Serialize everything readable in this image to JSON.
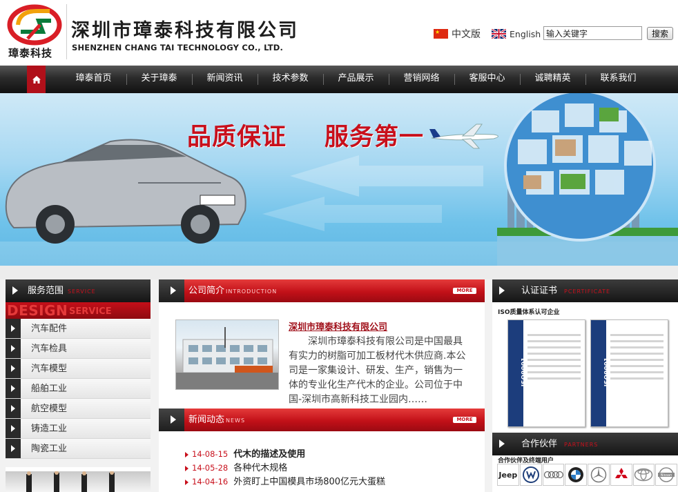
{
  "header": {
    "logo_short": "璋泰科技",
    "company_cn": "深圳市璋泰科技有限公司",
    "company_en": "SHENZHEN CHANG TAI TECHNOLOGY CO., LTD.",
    "lang_cn": "中文版",
    "lang_en": "English",
    "search_value": "输入关键字",
    "search_button": "搜索"
  },
  "nav": {
    "home_icon": "home-icon",
    "items": [
      "璋泰首页",
      "关于璋泰",
      "新闻资讯",
      "技术参数",
      "产品展示",
      "营销网络",
      "客服中心",
      "诚聘精英",
      "联系我们"
    ]
  },
  "banner": {
    "slogan_1": "品质保证",
    "slogan_2": "服务第一"
  },
  "services": {
    "title": "服务范围",
    "title_en": "SERVICE",
    "band_text": "DESIGN",
    "band_text_2": "SERVICE",
    "items": [
      "汽车配件",
      "汽车检具",
      "汽车模型",
      "船舶工业",
      "航空模型",
      "铸造工业",
      "陶瓷工业"
    ]
  },
  "intro": {
    "title": "公司简介",
    "title_en": "INTRODUCTION",
    "more": "MORE",
    "company": "深圳市璋泰科技有限公司",
    "text": "深圳市璋泰科技有限公司是中国最具有实力的树脂可加工板材代木供应商.本公司是一家集设计、研发、生产，销售为一体的专业化生产代木的企业。公司位于中国-深圳市高新科技工业园内……"
  },
  "news": {
    "title": "新闻动态",
    "title_en": "NEWS",
    "more": "MORE",
    "items": [
      {
        "date": "14-08-15",
        "title": "代木的描述及使用"
      },
      {
        "date": "14-05-28",
        "title": "各种代木规格"
      },
      {
        "date": "14-04-16",
        "title": "外资盯上中国模具市场800亿元大蛋糕"
      }
    ]
  },
  "certificate": {
    "title": "认证证书",
    "title_en": "PCERTIFICATE",
    "subtitle": "ISO质量体系认可企业",
    "band": "ISO9001"
  },
  "partners": {
    "title": "合作伙伴",
    "title_en": "PARTNERS",
    "subtitle": "合作伙伴及终端用户",
    "logos": [
      "Jeep",
      "VW",
      "Audi",
      "BMW",
      "Mercedes",
      "Mitsubishi",
      "Toyota",
      "Nissan"
    ]
  },
  "colors": {
    "brand_red": "#c8101c",
    "nav_dark": "#222222"
  }
}
